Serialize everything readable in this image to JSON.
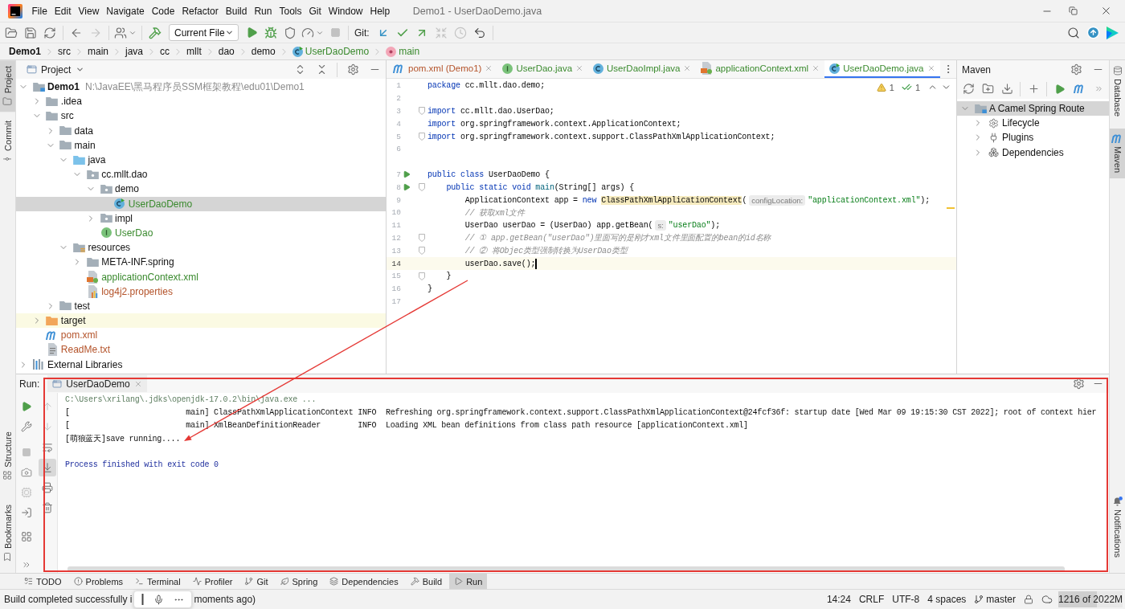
{
  "window": {
    "title": "Demo1 - UserDaoDemo.java"
  },
  "menu": [
    "File",
    "Edit",
    "View",
    "Navigate",
    "Code",
    "Refactor",
    "Build",
    "Run",
    "Tools",
    "Git",
    "Window",
    "Help"
  ],
  "toolbar": {
    "run_config": "Current File",
    "git_label": "Git:",
    "disabled": {
      "forward": true,
      "stop": true,
      "fetch": true,
      "history": true
    }
  },
  "breadcrumb": [
    {
      "label": "Demo1",
      "kind": "module"
    },
    {
      "label": "src",
      "kind": "folder"
    },
    {
      "label": "main",
      "kind": "folder"
    },
    {
      "label": "java",
      "kind": "folder"
    },
    {
      "label": "cc",
      "kind": "folder"
    },
    {
      "label": "mllt",
      "kind": "folder"
    },
    {
      "label": "dao",
      "kind": "folder"
    },
    {
      "label": "demo",
      "kind": "folder"
    },
    {
      "label": "UserDaoDemo",
      "kind": "class_runnable",
      "color": "#3a8a2e"
    },
    {
      "label": "main",
      "kind": "method",
      "color": "#3a8a2e"
    }
  ],
  "left_stripe": {
    "top": [
      {
        "label": "Project",
        "kind": "project",
        "selected": true
      },
      {
        "label": "Commit",
        "kind": "commit",
        "selected": false
      }
    ],
    "bottom": [
      {
        "label": "Structure",
        "kind": "structure",
        "selected": false
      },
      {
        "label": "Bookmarks",
        "kind": "bookmarks",
        "selected": false
      }
    ]
  },
  "project_panel": {
    "title": "Project",
    "tree": [
      {
        "label": "Demo1",
        "hint": "N:\\JavaEE\\黑马程序员SSM框架教程\\edu01\\Demo1",
        "kind": "module",
        "expanded": true,
        "selected": false,
        "children": [
          {
            "label": ".idea",
            "kind": "folder",
            "expanded": false,
            "selected": false
          },
          {
            "label": "src",
            "kind": "folder",
            "expanded": true,
            "selected": false,
            "children": [
              {
                "label": "data",
                "kind": "folder",
                "expanded": false,
                "selected": false
              },
              {
                "label": "main",
                "kind": "folder",
                "expanded": true,
                "selected": false,
                "children": [
                  {
                    "label": "java",
                    "kind": "source_root",
                    "expanded": true,
                    "selected": false,
                    "children": [
                      {
                        "label": "cc.mllt.dao",
                        "kind": "package",
                        "expanded": true,
                        "selected": false,
                        "children": [
                          {
                            "label": "demo",
                            "kind": "package",
                            "expanded": true,
                            "selected": false,
                            "children": [
                              {
                                "label": "UserDaoDemo",
                                "kind": "class_runnable",
                                "color": "#3a8a2e",
                                "selected": true
                              }
                            ]
                          },
                          {
                            "label": "impl",
                            "kind": "package",
                            "expanded": false,
                            "selected": false
                          },
                          {
                            "label": "UserDao",
                            "kind": "interface",
                            "color": "#3a8a2e",
                            "selected": false
                          }
                        ]
                      }
                    ]
                  },
                  {
                    "label": "resources",
                    "kind": "resources_root",
                    "expanded": true,
                    "selected": false,
                    "children": [
                      {
                        "label": "META-INF.spring",
                        "kind": "folder",
                        "expanded": false,
                        "selected": false
                      },
                      {
                        "label": "applicationContext.xml",
                        "kind": "xml_config",
                        "color": "#3a8a2e",
                        "selected": false
                      },
                      {
                        "label": "log4j2.properties",
                        "kind": "properties",
                        "color": "#b4532a",
                        "selected": false
                      }
                    ]
                  }
                ]
              },
              {
                "label": "test",
                "kind": "folder",
                "expanded": false,
                "selected": false
              }
            ]
          },
          {
            "label": "target",
            "kind": "excluded",
            "expanded": false,
            "selected": false
          },
          {
            "label": "pom.xml",
            "kind": "maven",
            "color": "#b4532a",
            "selected": false
          },
          {
            "label": "ReadMe.txt",
            "kind": "text",
            "color": "#b4532a",
            "selected": false
          }
        ]
      },
      {
        "label": "External Libraries",
        "kind": "libraries",
        "expanded": false,
        "selected": false
      }
    ]
  },
  "editor": {
    "tabs": [
      {
        "label": "pom.xml (Demo1)",
        "kind": "maven",
        "color": "#b4532a",
        "selected": false
      },
      {
        "label": "UserDao.java",
        "kind": "interface",
        "color": "#3a8a2e",
        "selected": false
      },
      {
        "label": "UserDaoImpl.java",
        "kind": "class",
        "color": "#3a8a2e",
        "selected": false
      },
      {
        "label": "applicationContext.xml",
        "kind": "xml_config",
        "color": "#3a8a2e",
        "selected": false
      },
      {
        "label": "UserDaoDemo.java",
        "kind": "class_runnable",
        "color": "#3a8a2e",
        "selected": true
      }
    ],
    "inspections": {
      "warnings": "1",
      "passed": "1"
    },
    "lines": [
      {
        "number": "1",
        "current": false,
        "run_marker": false,
        "fold_marker": false,
        "tokens": [
          {
            "kind": "keyword",
            "text": "package"
          },
          {
            "kind": "plain",
            "text": " cc.mllt.dao.demo;"
          }
        ]
      },
      {
        "number": "2",
        "current": false,
        "run_marker": false,
        "fold_marker": false
      },
      {
        "number": "3",
        "current": false,
        "run_marker": false,
        "fold_marker": true,
        "tokens": [
          {
            "kind": "keyword",
            "text": "import"
          },
          {
            "kind": "plain",
            "text": " cc.mllt.dao.UserDao;"
          }
        ]
      },
      {
        "number": "4",
        "current": false,
        "run_marker": false,
        "fold_marker": false,
        "tokens": [
          {
            "kind": "keyword",
            "text": "import"
          },
          {
            "kind": "plain",
            "text": " org.springframework.context.ApplicationContext;"
          }
        ]
      },
      {
        "number": "5",
        "current": false,
        "run_marker": false,
        "fold_marker": true,
        "tokens": [
          {
            "kind": "keyword",
            "text": "import"
          },
          {
            "kind": "plain",
            "text": " org.springframework.context.support.ClassPathXmlApplicationContext;"
          }
        ]
      },
      {
        "number": "6",
        "current": false,
        "run_marker": false,
        "fold_marker": false
      },
      {
        "number": "7",
        "current": false,
        "gap_before": true,
        "run_marker": true,
        "fold_marker": false,
        "tokens": [
          {
            "kind": "keyword",
            "text": "public class"
          },
          {
            "kind": "plain",
            "text": " UserDaoDemo {"
          }
        ]
      },
      {
        "number": "8",
        "current": false,
        "run_marker": true,
        "fold_marker": true,
        "tokens": [
          {
            "kind": "keyword",
            "text": "    public static void "
          },
          {
            "kind": "method",
            "text": "main"
          },
          {
            "kind": "plain",
            "text": "(String[] args) {"
          }
        ]
      },
      {
        "number": "9",
        "current": false,
        "run_marker": false,
        "fold_marker": false,
        "tokens": [
          {
            "kind": "plain",
            "text": "        ApplicationContext app = "
          },
          {
            "kind": "keyword",
            "text": "new "
          },
          {
            "kind": "usage",
            "text": "ClassPathXmlApplicationContext"
          },
          {
            "kind": "plain",
            "text": "("
          },
          {
            "kind": "hint",
            "text": "configLocation:"
          },
          {
            "kind": "string",
            "text": "\"applicationContext.xml\""
          },
          {
            "kind": "plain",
            "text": ");"
          }
        ]
      },
      {
        "number": "10",
        "current": false,
        "run_marker": false,
        "fold_marker": false,
        "tokens": [
          {
            "kind": "comment",
            "text": "        // 获取xml文件"
          }
        ]
      },
      {
        "number": "11",
        "current": false,
        "run_marker": false,
        "fold_marker": false,
        "tokens": [
          {
            "kind": "plain",
            "text": "        UserDao userDao = (UserDao) app.getBean("
          },
          {
            "kind": "hint",
            "text": "s:"
          },
          {
            "kind": "string",
            "text": "\"userDao\""
          },
          {
            "kind": "plain",
            "text": ");"
          }
        ]
      },
      {
        "number": "12",
        "current": false,
        "run_marker": false,
        "fold_marker": true,
        "tokens": [
          {
            "kind": "comment",
            "text": "        // ① app.getBean(\"userDao\")里面写的是刚才xml文件里面配置的bean的id名称"
          }
        ]
      },
      {
        "number": "13",
        "current": false,
        "run_marker": false,
        "fold_marker": true,
        "tokens": [
          {
            "kind": "comment",
            "text": "        // ② 将Objec类型强制转换为UserDao类型"
          }
        ]
      },
      {
        "number": "14",
        "current": true,
        "run_marker": false,
        "fold_marker": false,
        "tokens": [
          {
            "kind": "plain",
            "text": "        userDao.save();"
          }
        ]
      },
      {
        "number": "15",
        "current": false,
        "run_marker": false,
        "fold_marker": true,
        "tokens": [
          {
            "kind": "plain",
            "text": "    }"
          }
        ]
      },
      {
        "number": "16",
        "current": false,
        "run_marker": false,
        "fold_marker": false,
        "tokens": [
          {
            "kind": "plain",
            "text": "}"
          }
        ]
      },
      {
        "number": "17",
        "current": false,
        "run_marker": false,
        "fold_marker": false
      }
    ]
  },
  "maven_panel": {
    "title": "Maven",
    "tree": [
      {
        "label": "A Camel Spring Route",
        "kind": "maven_project",
        "expanded": true,
        "selected": true,
        "children": [
          {
            "label": "Lifecycle",
            "kind": "lifecycle",
            "expanded": false,
            "selected": false
          },
          {
            "label": "Plugins",
            "kind": "plugins",
            "expanded": false,
            "selected": false
          },
          {
            "label": "Dependencies",
            "kind": "dependencies",
            "expanded": false,
            "selected": false
          }
        ]
      }
    ]
  },
  "right_stripe": {
    "top": [
      {
        "label": "Database",
        "kind": "database",
        "selected": false
      },
      {
        "label": "Maven",
        "kind": "maven",
        "selected": true
      }
    ],
    "notifications": {
      "label": "Notifications",
      "unread": true
    }
  },
  "run_panel": {
    "label": "Run:",
    "tab": "UserDaoDemo",
    "disabled": {
      "stop": true,
      "thread_dump": true,
      "previous": true,
      "next": true
    },
    "toggled": {
      "scroll_to_end": true
    },
    "console": [
      {
        "kind": "command",
        "text": "C:\\Users\\xrilang\\.jdks\\openjdk-17.0.2\\bin\\java.exe ..."
      },
      {
        "kind": "output",
        "text": "[                         main] ClassPathXmlApplicationContext INFO  Refreshing org.springframework.context.support.ClassPathXmlApplicationContext@24fcf36f: startup date [Wed Mar 09 19:15:30 CST 2022]; root of context hier"
      },
      {
        "kind": "output",
        "text": "[                         main] XmlBeanDefinitionReader        INFO  Loading XML bean definitions from class path resource [applicationContext.xml]"
      },
      {
        "kind": "output",
        "text": "[萌狼蓝天]save running...."
      },
      {
        "kind": "blank"
      },
      {
        "kind": "system",
        "text": "Process finished with exit code 0"
      }
    ]
  },
  "tool_windows": [
    {
      "label": "TODO",
      "kind": "todo",
      "selected": false
    },
    {
      "label": "Problems",
      "kind": "problems",
      "selected": false
    },
    {
      "label": "Terminal",
      "kind": "terminal",
      "selected": false
    },
    {
      "label": "Profiler",
      "kind": "profiler",
      "selected": false
    },
    {
      "label": "Git",
      "kind": "git",
      "selected": false
    },
    {
      "label": "Spring",
      "kind": "spring",
      "selected": false
    },
    {
      "label": "Dependencies",
      "kind": "dependencies",
      "selected": false
    },
    {
      "label": "Build",
      "kind": "build",
      "selected": false
    },
    {
      "label": "Run",
      "kind": "run",
      "selected": true
    }
  ],
  "status_bar": {
    "message_start": "Build completed successfully i",
    "message_end": "moments ago)",
    "caret": "14:24",
    "line_ending": "CRLF",
    "encoding": "UTF-8",
    "indent": "4 spaces",
    "branch": "master",
    "memory": {
      "text": "1216 of 2022M",
      "level": 0.6
    }
  }
}
